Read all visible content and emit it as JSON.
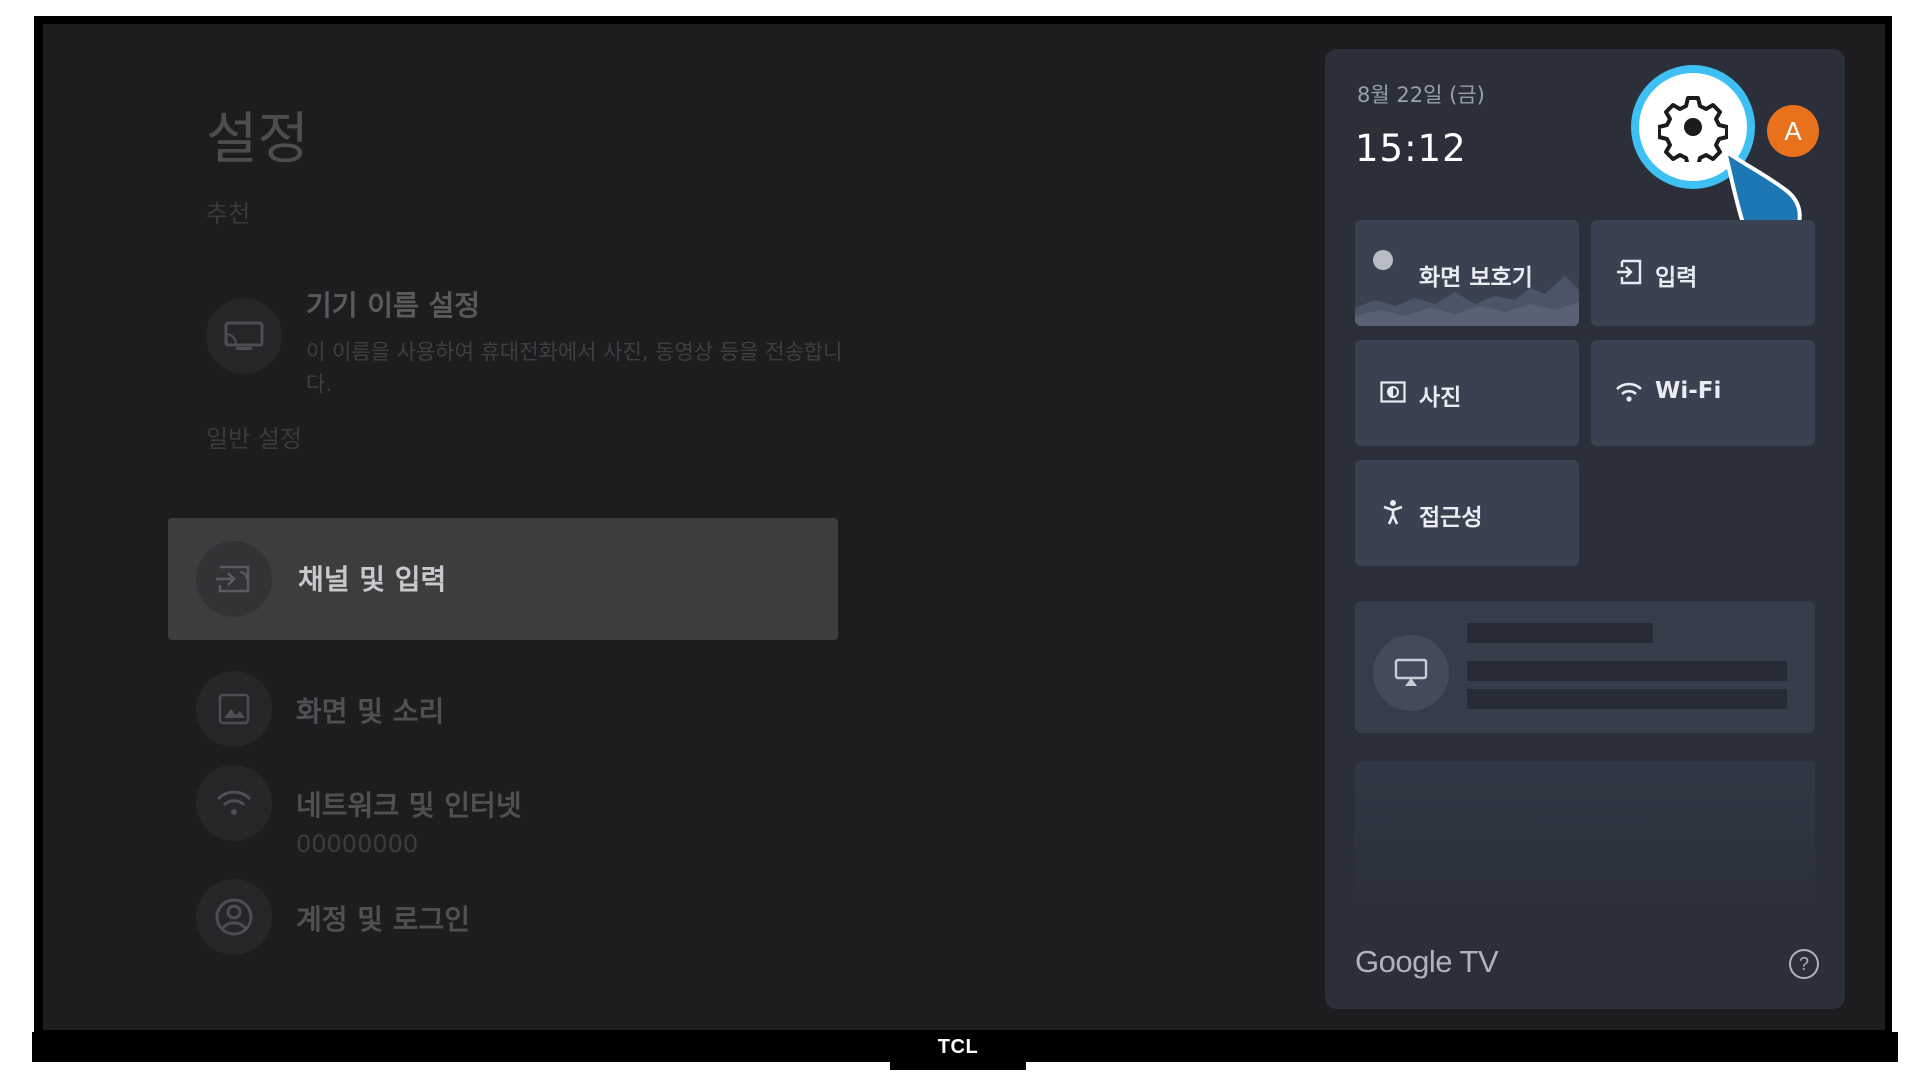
{
  "device": {
    "brand": "TCL"
  },
  "settings": {
    "title": "설정",
    "sections": {
      "recommended": "추천",
      "general": "일반 설정"
    },
    "recommended_item": {
      "title": "기기 이름 설정",
      "description": "이 이름을 사용하여 휴대전화에서 사진, 동영상 등을 전송합니다."
    },
    "menu": [
      {
        "label": "채널 및 입력",
        "icon": "input-icon",
        "focused": true
      },
      {
        "label": "화면 및 소리",
        "icon": "picture-icon"
      },
      {
        "label": "네트워크 및 인터넷",
        "sub": "00000000",
        "icon": "wifi-icon"
      },
      {
        "label": "계정 및 로그인",
        "icon": "account-icon"
      }
    ]
  },
  "quick_panel": {
    "date": "8월 22일 (금)",
    "time": "15:12",
    "avatar_letter": "A",
    "tiles": {
      "screensaver": "화면 보호기",
      "input": "입력",
      "photo": "사진",
      "wifi": "Wi-Fi",
      "accessibility": "접근성"
    },
    "footer_logo": "Google TV",
    "help": "?"
  },
  "colors": {
    "screen_bg": "#1d1d1f",
    "panel_bg": "#2a2f3a",
    "tile_bg": "#3a4252",
    "highlight_ring": "#3ec1f2",
    "avatar_bg": "#e8711c"
  }
}
